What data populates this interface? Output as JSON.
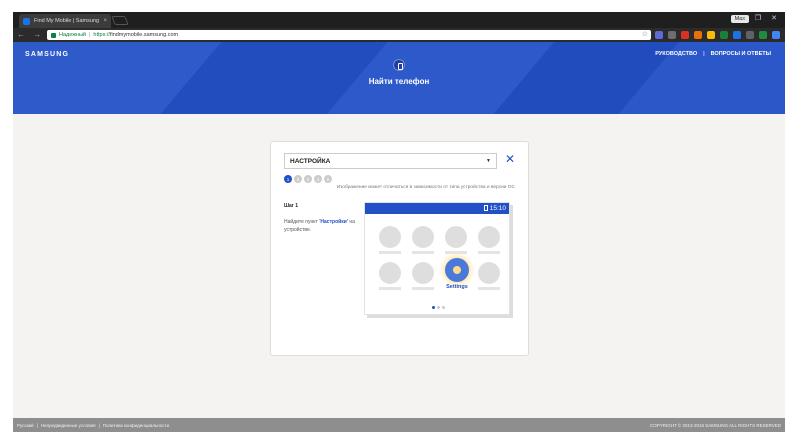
{
  "browser": {
    "tab_title": "Find My Mobile | Samsung",
    "tab_close": "×",
    "profile": "Max",
    "window_controls": "– ❐ ✕",
    "nav_glyphs": "← → C",
    "secure_label": "Надежный",
    "separator": "|",
    "url_protocol": "https://",
    "url_host": "findmymobile.samsung.com",
    "bookmark_icon": "☆",
    "extensions": [
      "#5a6cd6",
      "#6d6d6d",
      "#d93025",
      "#e8710a",
      "#fbbc04",
      "#188038",
      "#1a73e8",
      "#5f6368",
      "#1e8e3e",
      "#4285f4",
      "#9aa0a6",
      "#4285f4"
    ]
  },
  "header": {
    "logo": "SAMSUNG",
    "nav": [
      "РУКОВОДСТВО",
      "ВОПРОСЫ И ОТВЕТЫ"
    ],
    "nav_divider": "|",
    "title": "Найти телефон"
  },
  "card": {
    "select_value": "НАСТРОЙКА",
    "select_arrow": "▼",
    "close_glyph": "✕",
    "steps": [
      "1",
      "2",
      "3",
      "4",
      "5"
    ],
    "active_step": 1,
    "disclaimer": "Изображение может отличаться в зависимости от типа устройства и версии ОС",
    "step_title": "Шаг 1",
    "step_desc_pre": "Найдите пункт ",
    "step_desc_bold": "'Настройки'",
    "step_desc_post": " на устройстве.",
    "mock_time": "15:10",
    "settings_label": "Settings"
  },
  "footer": {
    "links": [
      "Русский",
      "|",
      "Непредвиденные условия",
      "|",
      "Политика конфиденциальности"
    ],
    "copyright": "COPYRIGHT © 2013-2016 SAMSUNG ALL RIGHTS RESERVED"
  }
}
